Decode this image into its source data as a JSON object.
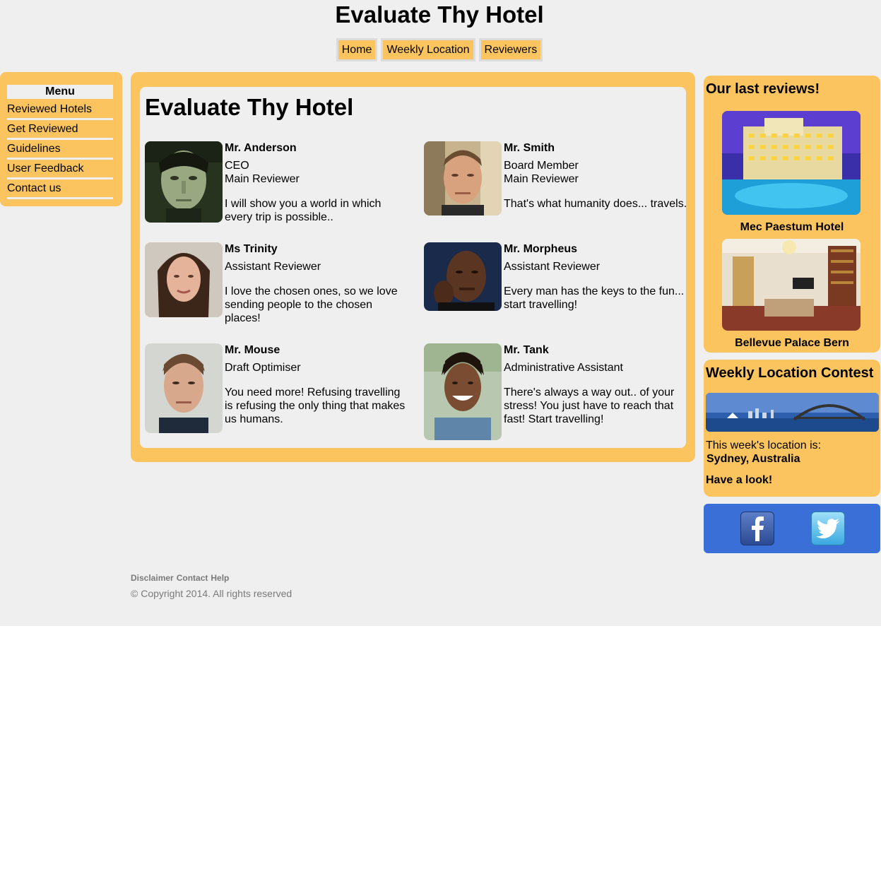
{
  "site": {
    "title": "Evaluate Thy Hotel"
  },
  "topnav": {
    "items": [
      "Home",
      "Weekly Location",
      "Reviewers"
    ]
  },
  "menu": {
    "title": "Menu",
    "items": [
      "Reviewed Hotels",
      "Get Reviewed",
      "Guidelines",
      "User Feedback",
      "Contact us"
    ]
  },
  "main": {
    "heading": "Evaluate Thy Hotel",
    "reviewers": [
      {
        "name": "Mr. Anderson",
        "role1": "CEO",
        "role2": "Main Reviewer",
        "quote": "I will show you a world in which every trip is possible.."
      },
      {
        "name": "Mr. Smith",
        "role1": "Board Member",
        "role2": "Main Reviewer",
        "quote": "That's what humanity does... travels."
      },
      {
        "name": "Ms Trinity",
        "role1": "Assistant Reviewer",
        "role2": "",
        "quote": "I love the chosen ones, so we love sending people to the chosen places!"
      },
      {
        "name": "Mr. Morpheus",
        "role1": "Assistant Reviewer",
        "role2": "",
        "quote": "Every man has the keys to the fun... start travelling!"
      },
      {
        "name": "Mr. Mouse",
        "role1": "Draft Optimiser",
        "role2": "",
        "quote": "You need more! Refusing travelling is refusing the only thing that makes us humans."
      },
      {
        "name": "Mr. Tank",
        "role1": "Administrative Assistant",
        "role2": "",
        "quote": "There's always a way out.. of your stress! You just have to reach that fast! Start travelling!"
      }
    ]
  },
  "reviews": {
    "heading": "Our last reviews!",
    "hotels": [
      "Mec Paestum Hotel",
      "Bellevue Palace Bern"
    ]
  },
  "contest": {
    "heading": "Weekly Location Contest",
    "intro": "This week's location is:",
    "location": "Sydney, Australia",
    "cta": "Have a look!"
  },
  "social": {
    "icons": [
      "facebook-icon",
      "twitter-icon"
    ]
  },
  "footer": {
    "links": [
      "Disclaimer",
      "Contact",
      "Help"
    ],
    "copyright": "© Copyright 2014. All rights reserved"
  },
  "colors": {
    "accent": "#fbc45e",
    "background": "#efefef",
    "social": "#3a6fd8"
  }
}
